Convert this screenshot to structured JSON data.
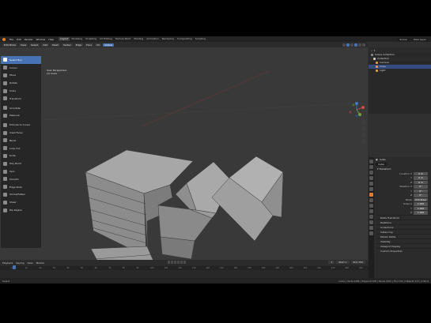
{
  "topbar": {
    "menus": [
      "File",
      "Edit",
      "Render",
      "Window",
      "Help"
    ],
    "tabs": [
      "Layout",
      "Modeling",
      "Sculpting",
      "UV Editing",
      "Texture Paint",
      "Shading",
      "Animation",
      "Rendering",
      "Compositing",
      "Scripting"
    ],
    "scene": "Scene",
    "view_layer": "View Layer"
  },
  "viewport": {
    "mode": "Edit Mode",
    "menus": [
      "View",
      "Select",
      "Add",
      "Mesh",
      "Vertex",
      "Edge",
      "Face",
      "UV"
    ],
    "transform": "Global",
    "view_name": "User Perspective",
    "object_name": "(1) Cube"
  },
  "toolbar": {
    "tools": [
      "Select Box",
      "Cursor",
      "Move",
      "Rotate",
      "Scale",
      "Transform",
      "Annotate",
      "Measure",
      "Extrude to Cursor",
      "Inset Faces",
      "Bevel",
      "Loop Cut",
      "Knife",
      "Poly Build",
      "Spin",
      "Smooth",
      "Edge Slide",
      "Shrink/Fatten",
      "Shear",
      "Rip Region"
    ]
  },
  "outliner": {
    "title": "Scene Collection",
    "rows": [
      "Collection",
      "Camera",
      "Cube",
      "Light"
    ]
  },
  "properties": {
    "object": "Cube",
    "data_name": "Cube",
    "section": "Transform",
    "location_label": "Location X",
    "rows": [
      {
        "label": "Location X",
        "value": "0 m"
      },
      {
        "label": "Y",
        "value": "0 m"
      },
      {
        "label": "Z",
        "value": "0 m"
      },
      {
        "label": "Rotation X",
        "value": "0°"
      },
      {
        "label": "Y",
        "value": "0°"
      },
      {
        "label": "Z",
        "value": "0°"
      },
      {
        "label": "Mode",
        "value": "XYZ Euler"
      },
      {
        "label": "Scale X",
        "value": "1.000"
      },
      {
        "label": "Y",
        "value": "1.000"
      },
      {
        "label": "Z",
        "value": "1.000"
      }
    ],
    "collapsed": [
      "Delta Transform",
      "Relations",
      "Collections",
      "Instancing",
      "Motion Paths",
      "Visibility",
      "Viewport Display",
      "Custom Properties"
    ]
  },
  "timeline": {
    "menus": [
      "Playback",
      "Keying",
      "View",
      "Marker"
    ],
    "current_frame": "1",
    "start": "Start 1",
    "end": "End 250",
    "ticks": [
      "0",
      "10",
      "20",
      "30",
      "40",
      "50",
      "60",
      "70",
      "80",
      "90",
      "100",
      "110",
      "120",
      "130",
      "140",
      "150",
      "160",
      "170",
      "180",
      "190",
      "200",
      "210",
      "220",
      "230",
      "240",
      "250"
    ]
  },
  "statusbar": {
    "left": "Select",
    "right": "Cube | Verts 0/68 | Edges 0/128 | Faces 0/62 | Tris 132 | Objects 1/3 | 2.90.0"
  }
}
